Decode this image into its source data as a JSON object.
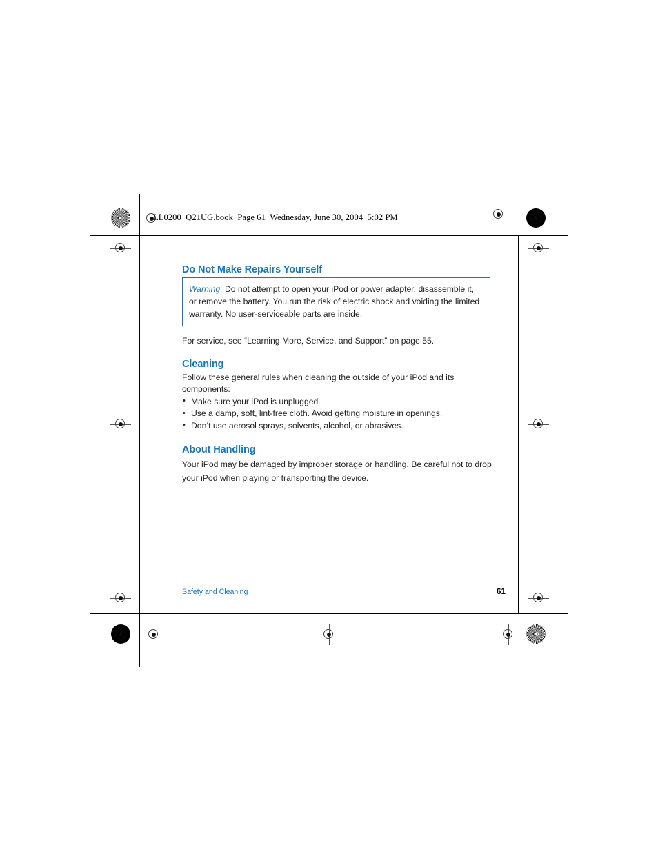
{
  "print_header": {
    "text": "LL0200_Q21UG.book  Page 61  Wednesday, June 30, 2004  5:02 PM"
  },
  "colors": {
    "heading_blue": "#1178bf",
    "body_text": "#231f20",
    "page_border": "#000000",
    "warning_border": "#1178bf"
  },
  "sections": {
    "repairs": {
      "heading": "Do Not Make Repairs Yourself",
      "warning_label": "Warning",
      "warning_text": "Do not attempt to open your iPod or power adapter, disassemble it, or remove the battery. You run the risk of electric shock and voiding the limited warranty. No user-serviceable parts are inside.",
      "service_line": "For service, see “Learning More, Service, and Support” on page 55."
    },
    "cleaning": {
      "heading": "Cleaning",
      "intro": "Follow these general rules when cleaning the outside of your iPod and its components:",
      "bullets": [
        "Make sure your iPod is unplugged.",
        "Use a damp, soft, lint-free cloth. Avoid getting moisture in openings.",
        "Don’t use aerosol sprays, solvents, alcohol, or abrasives."
      ]
    },
    "handling": {
      "heading": "About Handling",
      "body": "Your iPod may be damaged by improper storage or handling. Be careful not to drop your iPod when playing or transporting the device."
    }
  },
  "footer": {
    "chapter": "Safety and Cleaning",
    "page_number": "61"
  },
  "marks": {
    "registration_star": "starburst-registration-mark",
    "registration_dense": "dense-registration-mark",
    "registration_target": "crosshair-target-mark"
  }
}
